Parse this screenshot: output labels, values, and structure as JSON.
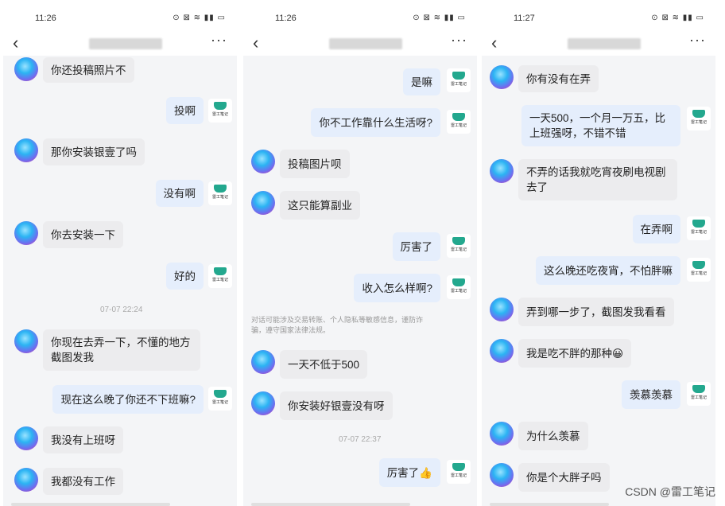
{
  "logo_text": "雷工笔记",
  "watermark": "CSDN @雷工笔记",
  "panels": [
    {
      "time": "11:26",
      "status_icons": "⊙ ⊠ ≋ ▮▮ ▭",
      "timestamp": "07-07 22:24",
      "messages": [
        {
          "side": "left",
          "text": "你还投稿照片不"
        },
        {
          "side": "right",
          "text": "投啊"
        },
        {
          "side": "left",
          "text": "那你安装银壹了吗"
        },
        {
          "side": "right",
          "text": "没有啊"
        },
        {
          "side": "left",
          "text": "你去安装一下"
        },
        {
          "side": "right",
          "text": "好的"
        },
        {
          "side": "left",
          "text": "你现在去弄一下，不懂的地方截图发我"
        },
        {
          "side": "right",
          "text": "现在这么晚了你还不下班嘛?"
        },
        {
          "side": "left",
          "text": "我没有上班呀"
        },
        {
          "side": "left",
          "text": "我都没有工作"
        }
      ]
    },
    {
      "time": "11:26",
      "status_icons": "⊙ ⊠ ≋ ▮▮ ▭",
      "notice": "对话可能涉及交易转账、个人隐私等敏感信息，谨防诈骗，遵守国家法律法规。",
      "timestamp": "07-07 22:37",
      "messages": [
        {
          "side": "right",
          "text": "是嘛"
        },
        {
          "side": "right",
          "text": "你不工作靠什么生活呀?"
        },
        {
          "side": "left",
          "text": "投稿图片呗"
        },
        {
          "side": "left",
          "text": "这只能算副业"
        },
        {
          "side": "right",
          "text": "厉害了"
        },
        {
          "side": "right",
          "text": "收入怎么样啊?"
        },
        {
          "side": "left",
          "text": "一天不低于500"
        },
        {
          "side": "left",
          "text": "你安装好银壹没有呀"
        },
        {
          "side": "right",
          "text": "厉害了👍"
        }
      ]
    },
    {
      "time": "11:27",
      "status_icons": "⊙ ⊠ ≋ ▮▮ ▭",
      "messages": [
        {
          "side": "left",
          "text": "你有没有在弄"
        },
        {
          "side": "right",
          "text": "一天500，一个月一万五，比上班强呀，不错不错"
        },
        {
          "side": "left",
          "text": "不弄的话我就吃宵夜刷电视剧去了"
        },
        {
          "side": "right",
          "text": "在弄啊"
        },
        {
          "side": "right",
          "text": "这么晚还吃夜宵，不怕胖嘛"
        },
        {
          "side": "left",
          "text": "弄到哪一步了，截图发我看看"
        },
        {
          "side": "left",
          "text": "我是吃不胖的那种😀"
        },
        {
          "side": "right",
          "text": "羡慕羡慕"
        },
        {
          "side": "left",
          "text": "为什么羡慕"
        },
        {
          "side": "left",
          "text": "你是个大胖子吗"
        }
      ]
    }
  ]
}
